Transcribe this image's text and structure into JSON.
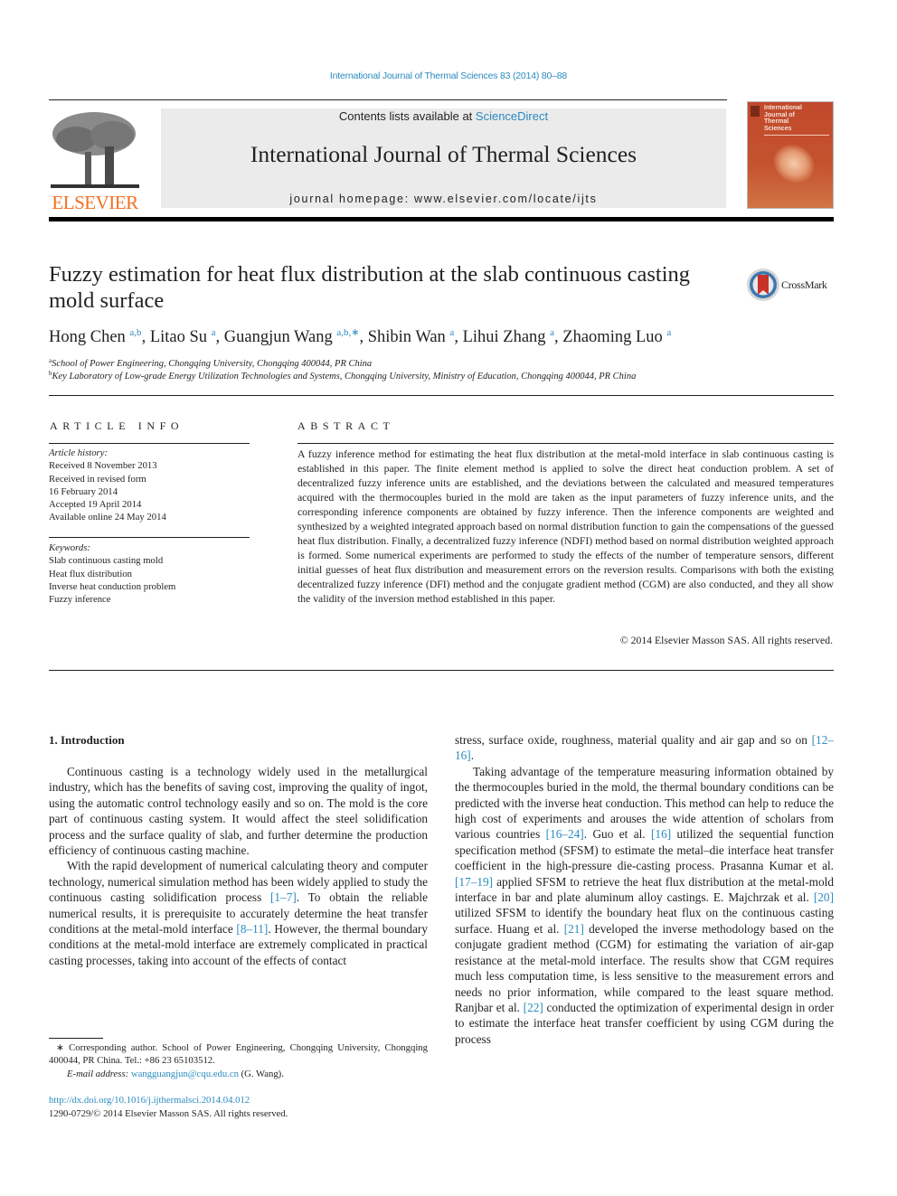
{
  "header": {
    "journal_ref": "International Journal of Thermal Sciences 83 (2014) 80–88",
    "contents_prefix": "Contents lists available at ",
    "contents_link": "ScienceDirect",
    "journal_name": "International Journal of Thermal Sciences",
    "homepage": "journal homepage: www.elsevier.com/locate/ijts",
    "publisher_logo_text": "ELSEVIER",
    "cover_title": "International Journal of Thermal Sciences",
    "brand_color": "#f37021",
    "link_color": "#2a8bbf"
  },
  "article": {
    "title": "Fuzzy estimation for heat flux distribution at the slab continuous casting mold surface",
    "crossmark_label": "CrossMark",
    "authors": [
      {
        "name": "Hong Chen",
        "sup": "a,b",
        "sep": ", "
      },
      {
        "name": "Litao Su",
        "sup": "a",
        "sep": ", "
      },
      {
        "name": "Guangjun Wang",
        "sup": "a,b,∗",
        "sep": ", "
      },
      {
        "name": "Shibin Wan",
        "sup": "a",
        "sep": ", "
      },
      {
        "name": "Lihui Zhang",
        "sup": "a",
        "sep": ", "
      },
      {
        "name": "Zhaoming Luo",
        "sup": "a",
        "sep": ""
      }
    ],
    "affiliations": [
      {
        "mark": "a",
        "text": "School of Power Engineering, Chongqing University, Chongqing 400044, PR China"
      },
      {
        "mark": "b",
        "text": "Key Laboratory of Low-grade Energy Utilization Technologies and Systems, Chongqing University, Ministry of Education, Chongqing 400044, PR China"
      }
    ]
  },
  "article_info": {
    "heading": "ARTICLE INFO",
    "history_label": "Article history:",
    "history": [
      "Received 8 November 2013",
      "Received in revised form",
      "16 February 2014",
      "Accepted 19 April 2014",
      "Available online 24 May 2014"
    ],
    "keywords_label": "Keywords:",
    "keywords": [
      "Slab continuous casting mold",
      "Heat flux distribution",
      "Inverse heat conduction problem",
      "Fuzzy inference"
    ]
  },
  "abstract": {
    "heading": "ABSTRACT",
    "text": "A fuzzy inference method for estimating the heat flux distribution at the metal-mold interface in slab continuous casting is established in this paper. The finite element method is applied to solve the direct heat conduction problem. A set of decentralized fuzzy inference units are established, and the deviations between the calculated and measured temperatures acquired with the thermocouples buried in the mold are taken as the input parameters of fuzzy inference units, and the corresponding inference components are obtained by fuzzy inference. Then the inference components are weighted and synthesized by a weighted integrated approach based on normal distribution function to gain the compensations of the guessed heat flux distribution. Finally, a decentralized fuzzy inference (NDFI) method based on normal distribution weighted approach is formed. Some numerical experiments are performed to study the effects of the number of temperature sensors, different initial guesses of heat flux distribution and measurement errors on the reversion results. Comparisons with both the existing decentralized fuzzy inference (DFI) method and the conjugate gradient method (CGM) are also conducted, and they all show the validity of the inversion method established in this paper.",
    "copyright": "© 2014 Elsevier Masson SAS. All rights reserved."
  },
  "body": {
    "section_heading": "1.  Introduction",
    "left_paragraphs": [
      [
        {
          "t": "Continuous casting is a technology widely used in the metallurgical industry, which has the benefits of saving cost, improving the quality of ingot, using the automatic control technology easily and so on. The mold is the core part of continuous casting system. It would affect the steel solidification process and the surface quality of slab, and further determine the production efficiency of continuous casting machine."
        }
      ],
      [
        {
          "t": "With the rapid development of numerical calculating theory and computer technology, numerical simulation method has been widely applied to study the continuous casting solidification process "
        },
        {
          "t": "[1–7]",
          "link": true
        },
        {
          "t": ". To obtain the reliable numerical results, it is prerequisite to accurately determine the heat transfer conditions at the metal-mold interface "
        },
        {
          "t": "[8–11]",
          "link": true
        },
        {
          "t": ". However, the thermal boundary conditions at the metal-mold interface are extremely complicated in practical casting processes, taking into account of the effects of contact"
        }
      ]
    ],
    "right_paragraphs": [
      [
        {
          "t": "stress, surface oxide, roughness, material quality and air gap and so on "
        },
        {
          "t": "[12–16]",
          "link": true
        },
        {
          "t": "."
        }
      ],
      [
        {
          "t": "Taking advantage of the temperature measuring information obtained by the thermocouples buried in the mold, the thermal boundary conditions can be predicted with the inverse heat conduction. This method can help to reduce the high cost of experiments and arouses the wide attention of scholars from various countries "
        },
        {
          "t": "[16–24]",
          "link": true
        },
        {
          "t": ". Guo et al. "
        },
        {
          "t": "[16]",
          "link": true
        },
        {
          "t": " utilized the sequential function specification method (SFSM) to estimate the metal–die interface heat transfer coefficient in the high-pressure die-casting process. Prasanna Kumar et al. "
        },
        {
          "t": "[17–19]",
          "link": true
        },
        {
          "t": " applied SFSM to retrieve the heat flux distribution at the metal-mold interface in bar and plate aluminum alloy castings. E. Majchrzak et al. "
        },
        {
          "t": "[20]",
          "link": true
        },
        {
          "t": " utilized SFSM to identify the boundary heat flux on the continuous casting surface. Huang et al. "
        },
        {
          "t": "[21]",
          "link": true
        },
        {
          "t": " developed the inverse methodology based on the conjugate gradient method (CGM) for estimating the variation of air-gap resistance at the metal-mold interface. The results show that CGM requires much less computation time, is less sensitive to the measurement errors and needs no prior information, while compared to the least square method. Ranjbar et al. "
        },
        {
          "t": "[22]",
          "link": true
        },
        {
          "t": " conducted the optimization of experimental design in order to estimate the interface heat transfer coefficient by using CGM during the process"
        }
      ]
    ]
  },
  "footnote": {
    "corresponding": "∗ Corresponding author. School of Power Engineering, Chongqing University, Chongqing 400044, PR China. Tel.: +86 23 65103512.",
    "email_label": "E-mail address: ",
    "email": "wangguangjun@cqu.edu.cn",
    "email_suffix": " (G. Wang).",
    "doi": "http://dx.doi.org/10.1016/j.ijthermalsci.2014.04.012",
    "issn": "1290-0729/© 2014 Elsevier Masson SAS. All rights reserved."
  }
}
